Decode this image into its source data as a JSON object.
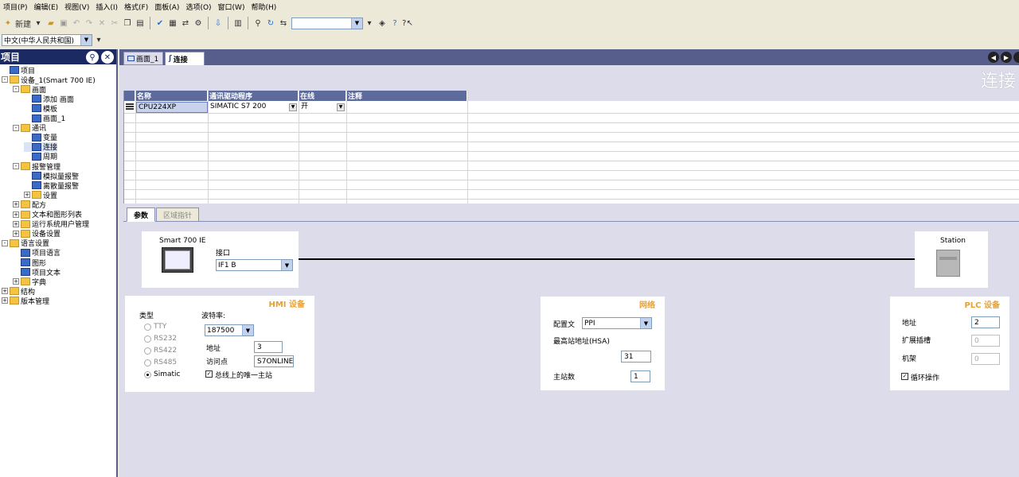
{
  "menu": [
    "项目(P)",
    "编辑(E)",
    "视图(V)",
    "插入(I)",
    "格式(F)",
    "面板(A)",
    "选项(O)",
    "窗口(W)",
    "帮助(H)"
  ],
  "toolbar": {
    "new_label": "新建"
  },
  "language_combo": "中文(中华人民共和国)",
  "project_panel": {
    "title": "项目",
    "tree": [
      {
        "label": "项目",
        "level": 0,
        "toggle": ""
      },
      {
        "label": "设备_1(Smart 700 IE)",
        "level": 0,
        "toggle": "-"
      },
      {
        "label": "画面",
        "level": 1,
        "toggle": "-"
      },
      {
        "label": "添加 画面",
        "level": 2,
        "toggle": ""
      },
      {
        "label": "模板",
        "level": 2,
        "toggle": ""
      },
      {
        "label": "画面_1",
        "level": 2,
        "toggle": ""
      },
      {
        "label": "通讯",
        "level": 1,
        "toggle": "-"
      },
      {
        "label": "变量",
        "level": 2,
        "toggle": ""
      },
      {
        "label": "连接",
        "level": 2,
        "toggle": ""
      },
      {
        "label": "周期",
        "level": 2,
        "toggle": ""
      },
      {
        "label": "报警管理",
        "level": 1,
        "toggle": "-"
      },
      {
        "label": "模拟量报警",
        "level": 2,
        "toggle": ""
      },
      {
        "label": "离散量报警",
        "level": 2,
        "toggle": ""
      },
      {
        "label": "设置",
        "level": 2,
        "toggle": "+"
      },
      {
        "label": "配方",
        "level": 1,
        "toggle": "+"
      },
      {
        "label": "文本和图形列表",
        "level": 1,
        "toggle": "+"
      },
      {
        "label": "运行系统用户管理",
        "level": 1,
        "toggle": "+"
      },
      {
        "label": "设备设置",
        "level": 1,
        "toggle": "+"
      },
      {
        "label": "语言设置",
        "level": 0,
        "toggle": "-"
      },
      {
        "label": "项目语言",
        "level": 1,
        "toggle": ""
      },
      {
        "label": "图形",
        "level": 1,
        "toggle": ""
      },
      {
        "label": "项目文本",
        "level": 1,
        "toggle": ""
      },
      {
        "label": "字典",
        "level": 1,
        "toggle": "+"
      },
      {
        "label": "结构",
        "level": 0,
        "toggle": "+"
      },
      {
        "label": "版本管理",
        "level": 0,
        "toggle": "+"
      }
    ]
  },
  "tabs": [
    {
      "label": "画面_1"
    },
    {
      "label": "连接"
    }
  ],
  "editor_title": "连接",
  "grid": {
    "headers": [
      "名称",
      "通讯驱动程序",
      "在线",
      "注释"
    ],
    "row": {
      "name": "CPU224XP",
      "driver": "SIMATIC S7 200",
      "online": "开",
      "comment": ""
    }
  },
  "lower_tabs": [
    "参数",
    "区域指针"
  ],
  "hmi_device": {
    "name": "Smart 700 IE",
    "interface_label": "接口",
    "interface_value": "IF1 B"
  },
  "station": {
    "name": "Station"
  },
  "hmi_settings": {
    "title": "HMI 设备",
    "type_label": "类型",
    "types": [
      "TTY",
      "RS232",
      "RS422",
      "RS485",
      "Simatic"
    ],
    "selected_type": "Simatic",
    "baud_label": "波特率:",
    "baud_value": "187500",
    "address_label": "地址",
    "address_value": "3",
    "access_point_label": "访问点",
    "access_point_value": "S7ONLINE",
    "only_master_label": "总线上的唯一主站"
  },
  "network": {
    "title": "网络",
    "profile_label": "配置文",
    "profile_value": "PPI",
    "hsa_label": "最高站地址(HSA)",
    "hsa_value": "31",
    "masters_label": "主站数",
    "masters_value": "1"
  },
  "plc": {
    "title": "PLC 设备",
    "address_label": "地址",
    "address_value": "2",
    "slot_label": "扩展插槽",
    "slot_value": "0",
    "rack_label": "机架",
    "rack_value": "0",
    "cyclic_label": "循环操作"
  }
}
